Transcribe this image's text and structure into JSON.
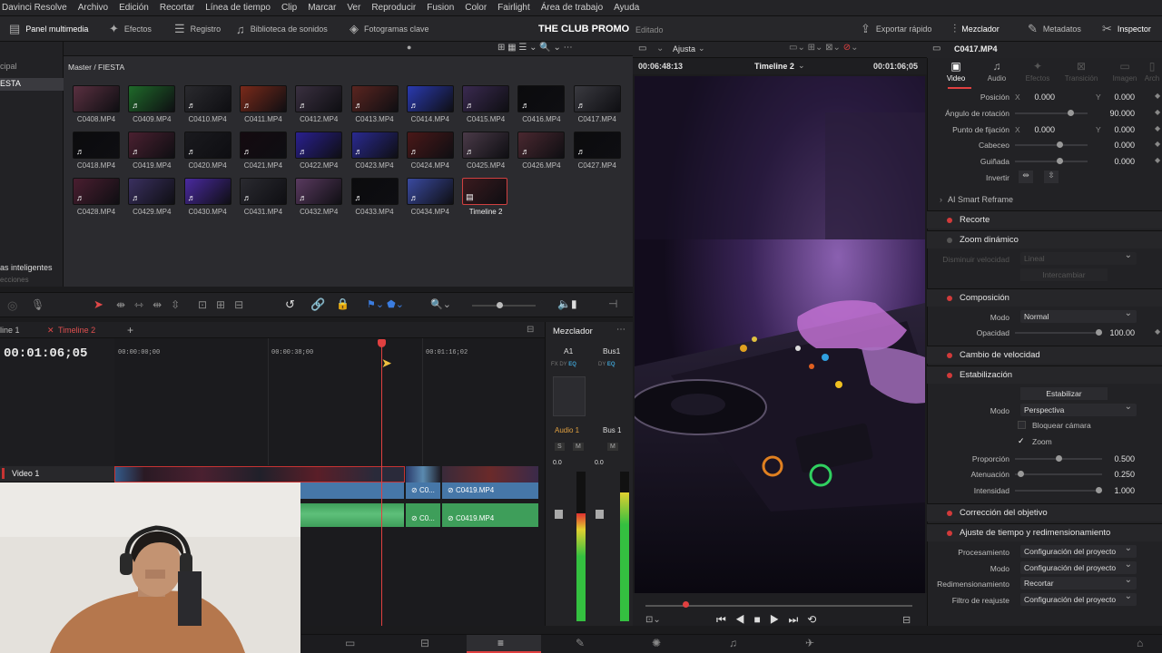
{
  "menu": [
    "Davinci Resolve",
    "Archivo",
    "Edición",
    "Recortar",
    "Línea de tiempo",
    "Clip",
    "Marcar",
    "Ver",
    "Reproducir",
    "Fusion",
    "Color",
    "Fairlight",
    "Área de trabajo",
    "Ayuda"
  ],
  "toolbar": {
    "media_pool": "Panel multimedia",
    "effects": "Efectos",
    "log": "Registro",
    "sound_library": "Biblioteca de sonidos",
    "keyframes": "Fotogramas clave",
    "project_title": "THE CLUB PROMO",
    "project_status": "Editado",
    "quick_export": "Exportar rápido",
    "mixer": "Mezclador",
    "metadata": "Metadatos",
    "inspector": "Inspector"
  },
  "pool": {
    "left_label": "cipal",
    "left_selected": "ESTA",
    "smart_bins": "as inteligentes",
    "smart_sub": "ecciones",
    "breadcrumb": "Master / FIESTA",
    "clips": [
      {
        "name": "C0408.MP4",
        "color": "#5a3040",
        "audio": false
      },
      {
        "name": "C0409.MP4",
        "color": "#1f6a2a",
        "audio": true
      },
      {
        "name": "C0410.MP4",
        "color": "#2a2a2e",
        "audio": true
      },
      {
        "name": "C0411.MP4",
        "color": "#7a2a1a",
        "audio": true
      },
      {
        "name": "C0412.MP4",
        "color": "#3a3040",
        "audio": true
      },
      {
        "name": "C0413.MP4",
        "color": "#5a2520",
        "audio": true
      },
      {
        "name": "C0414.MP4",
        "color": "#2a3ab0",
        "audio": true
      },
      {
        "name": "C0415.MP4",
        "color": "#3a2a50",
        "audio": true
      },
      {
        "name": "C0416.MP4",
        "color": "#0b0b0d",
        "audio": true
      },
      {
        "name": "C0417.MP4",
        "color": "#3a3a40",
        "audio": true
      },
      {
        "name": "C0418.MP4",
        "color": "#0b0b0d",
        "audio": true
      },
      {
        "name": "C0419.MP4",
        "color": "#4a2030",
        "audio": true
      },
      {
        "name": "C0420.MP4",
        "color": "#1a1a1e",
        "audio": true
      },
      {
        "name": "C0421.MP4",
        "color": "#140a10",
        "audio": true
      },
      {
        "name": "C0422.MP4",
        "color": "#2a2090",
        "audio": true
      },
      {
        "name": "C0423.MP4",
        "color": "#2a2a90",
        "audio": true
      },
      {
        "name": "C0424.MP4",
        "color": "#4a1818",
        "audio": true
      },
      {
        "name": "C0425.MP4",
        "color": "#4a3a48",
        "audio": true
      },
      {
        "name": "C0426.MP4",
        "color": "#4a2830",
        "audio": true
      },
      {
        "name": "C0427.MP4",
        "color": "#0b0b0d",
        "audio": true
      },
      {
        "name": "C0428.MP4",
        "color": "#4a1e30",
        "audio": true
      },
      {
        "name": "C0429.MP4",
        "color": "#3a3060",
        "audio": true
      },
      {
        "name": "C0430.MP4",
        "color": "#4a2aa0",
        "audio": true
      },
      {
        "name": "C0431.MP4",
        "color": "#2a2a30",
        "audio": true
      },
      {
        "name": "C0432.MP4",
        "color": "#5a3a60",
        "audio": true
      },
      {
        "name": "C0433.MP4",
        "color": "#0b0b0d",
        "audio": true
      },
      {
        "name": "C0434.MP4",
        "color": "#3a4aa0",
        "audio": true
      },
      {
        "name": "Timeline 2",
        "color": "#3a1a1e",
        "audio": false
      }
    ]
  },
  "timeline": {
    "tab1": "line 1",
    "tab2": "Timeline 2",
    "timecode": "00:01:06;05",
    "ruler": [
      "00:00:00;00",
      "00:00:38;00",
      "00:01:16;02"
    ],
    "track_label": "Video 1",
    "clip_a": "C0...",
    "clip_b": "C0419.MP4"
  },
  "mixer": {
    "title": "Mezclador",
    "ch1": "A1",
    "ch2": "Bus1",
    "audio1": "Audio 1",
    "bus1": "Bus 1",
    "db": "0.0",
    "levels": {
      "audio1": 0.72,
      "bus1": 0.86
    }
  },
  "viewer": {
    "zoom": "Ajusta",
    "timecode_left": "00:06:48:13",
    "timeline_name": "Timeline 2",
    "timecode_right": "00:01:06;05"
  },
  "inspector": {
    "clip": "C0417.MP4",
    "tabs": [
      "Video",
      "Audio",
      "Efectos",
      "Transición",
      "Imagen",
      "Arch"
    ],
    "transform": [
      {
        "label": "Posición",
        "x": "0.000",
        "y": "0.000"
      },
      {
        "label": "Ángulo de rotación",
        "v": "90.000"
      },
      {
        "label": "Punto de fijación",
        "x": "0.000",
        "y": "0.000"
      },
      {
        "label": "Cabeceo",
        "v": "0.000"
      },
      {
        "label": "Guiñada",
        "v": "0.000"
      },
      {
        "label": "Invertir"
      }
    ],
    "ai_reframe": "AI Smart Reframe",
    "recorte": "Recorte",
    "zoom_dinamico": "Zoom dinámico",
    "zoom_speed_label": "Disminuir velocidad",
    "zoom_speed_value": "Lineal",
    "swap": "Intercambiar",
    "composicion": "Composición",
    "modo": "Modo",
    "modo_value": "Normal",
    "opacidad": "Opacidad",
    "opacidad_value": "100.00",
    "cambio_velocidad": "Cambio de velocidad",
    "estabilizacion": "Estabilización",
    "estabilizar": "Estabilizar",
    "estab_modo_value": "Perspectiva",
    "bloquear": "Bloquear cámara",
    "zoom": "Zoom",
    "proporcion": "Proporción",
    "proporcion_value": "0.500",
    "atenuacion": "Atenuación",
    "atenuacion_value": "0.250",
    "intensidad": "Intensidad",
    "intensidad_value": "1.000",
    "correccion": "Corrección del objetivo",
    "ajuste": "Ajuste de tiempo y redimensionamiento",
    "procesamiento": "Procesamiento",
    "procesamiento_value": "Configuración del proyecto",
    "modo2_value": "Configuración del proyecto",
    "redim": "Redimensionamiento",
    "redim_value": "Recortar",
    "filtro": "Filtro de reajuste",
    "filtro_value": "Configuración del proyecto"
  }
}
